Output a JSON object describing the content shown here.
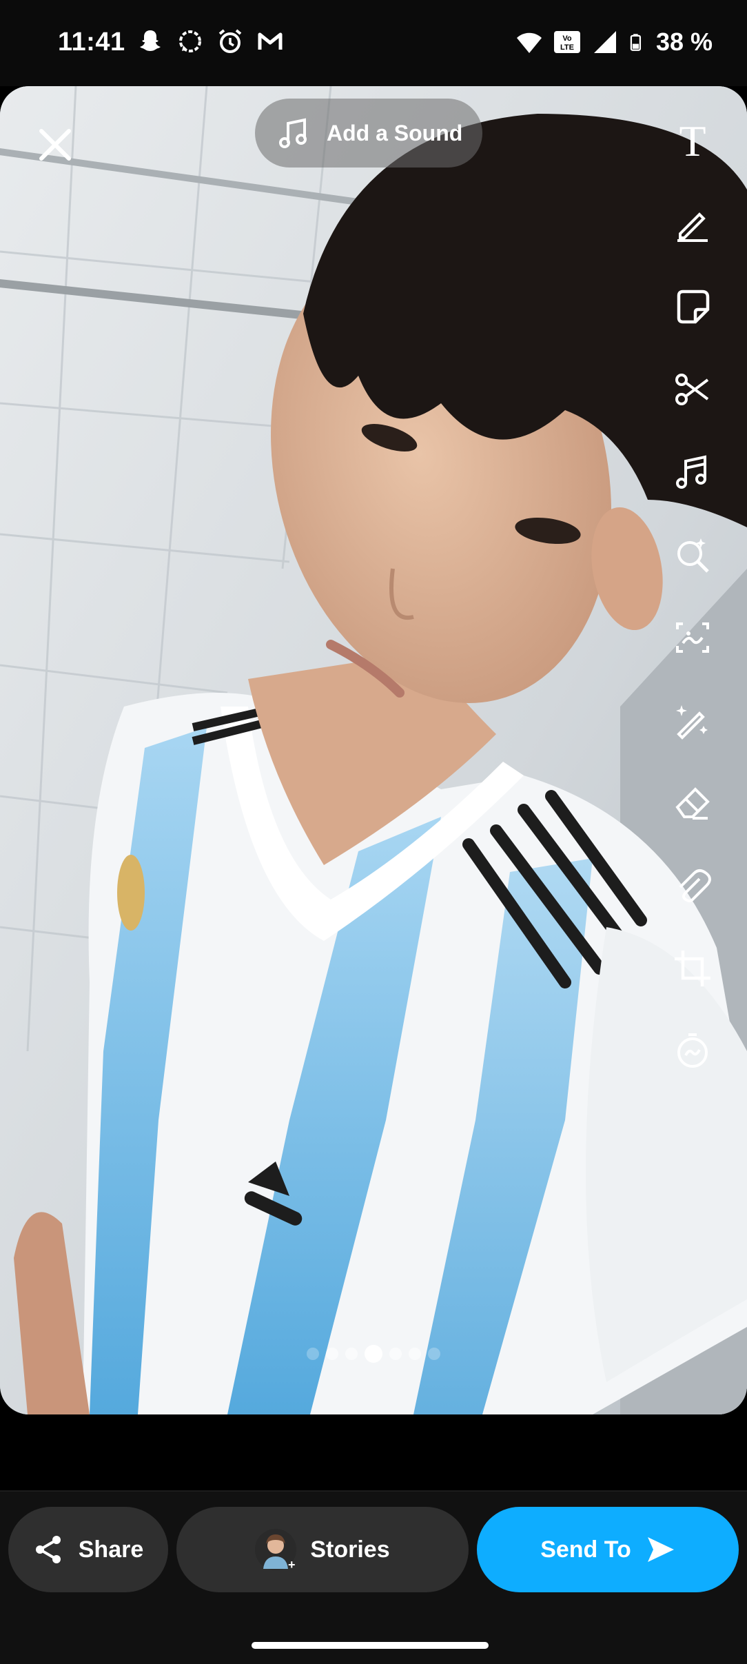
{
  "status_bar": {
    "time": "11:41",
    "battery_percent": "38 %",
    "left_icons": [
      "snapchat-icon",
      "signal-app-icon",
      "alarm-icon",
      "gmail-icon"
    ],
    "right_icons": [
      "wifi-icon",
      "volte-icon",
      "cell-signal-icon",
      "battery-icon"
    ],
    "volte_text": "Vo LTE"
  },
  "editor": {
    "sound_label": "Add a Sound",
    "tools": [
      "text-tool-icon",
      "pen-tool-icon",
      "sticker-tool-icon",
      "scissors-tool-icon",
      "music-tool-icon",
      "lens-search-tool-icon",
      "scan-tool-icon",
      "magic-wand-tool-icon",
      "eraser-tool-icon",
      "attachment-tool-icon",
      "crop-tool-icon",
      "timer-tool-icon"
    ],
    "text_tool_glyph": "T",
    "page_dots": {
      "count": 7,
      "active_index": 3
    }
  },
  "bottom": {
    "share_label": "Share",
    "stories_label": "Stories",
    "send_label": "Send To"
  },
  "colors": {
    "send_button": "#0eadff",
    "secondary_button": "#2f2f2f",
    "jersey_blue": "#7cc4ee"
  }
}
